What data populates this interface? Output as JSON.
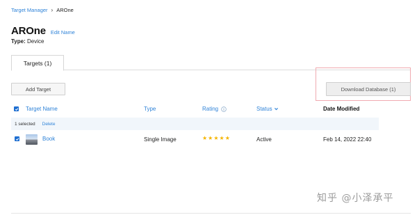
{
  "breadcrumb": {
    "parent": "Target Manager",
    "separator": "›",
    "current": "AROne"
  },
  "header": {
    "title": "AROne",
    "edit_link": "Edit Name",
    "type_label": "Type:",
    "type_value": "Device"
  },
  "tabs": [
    {
      "label": "Targets (1)",
      "active": true
    }
  ],
  "toolbar": {
    "add_target": "Add Target",
    "download_database": "Download Database (1)"
  },
  "table": {
    "columns": {
      "name": "Target Name",
      "type": "Type",
      "rating": "Rating",
      "rating_info_icon": "info-icon",
      "status": "Status",
      "status_sort_icon": "chevron-down-icon",
      "date_modified": "Date Modified"
    },
    "selection": {
      "count_text": "1 selected",
      "delete": "Delete"
    },
    "rows": [
      {
        "name": "Book",
        "type": "Single Image",
        "rating": 5,
        "rating_max": 5,
        "status": "Active",
        "date_modified": "Feb 14, 2022 22:40",
        "checked": true
      }
    ]
  },
  "watermark": "知乎 @小泽承平",
  "colors": {
    "accent": "#2f83d8",
    "checkbox": "#1f6fd1",
    "star": "#f5b400",
    "highlight": "#f0aab0"
  }
}
